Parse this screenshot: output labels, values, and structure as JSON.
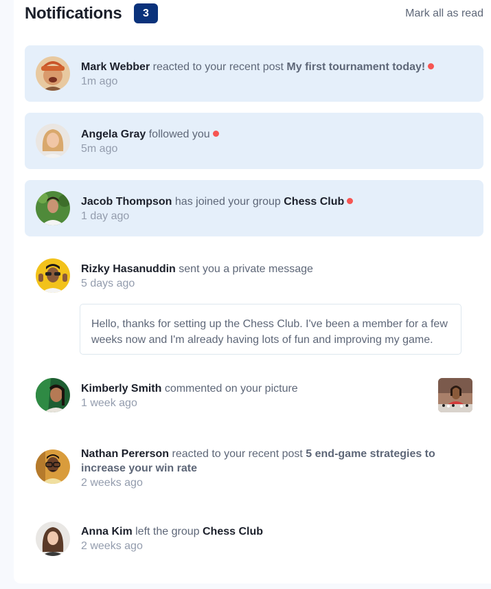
{
  "header": {
    "title": "Notifications",
    "badge_count": "3",
    "mark_all_label": "Mark all as read"
  },
  "notifications": [
    {
      "name": "Mark Webber",
      "action": "reacted to your recent post",
      "target": "My first tournament today!",
      "time": "1m ago",
      "unread": true,
      "avatar": "avatar-mark-webber"
    },
    {
      "name": "Angela Gray",
      "action": "followed you",
      "target": "",
      "time": "5m ago",
      "unread": true,
      "avatar": "avatar-angela-gray"
    },
    {
      "name": "Jacob Thompson",
      "action": "has joined your group",
      "target": "Chess Club",
      "time": "1 day ago",
      "unread": true,
      "avatar": "avatar-jacob-thompson"
    },
    {
      "name": "Rizky Hasanuddin",
      "action": "sent you a private message",
      "target": "",
      "time": "5 days ago",
      "unread": false,
      "avatar": "avatar-rizky-hasanuddin",
      "message": "Hello, thanks for setting up the Chess Club. I've been a member for a few weeks now and I'm already having lots of fun and improving my game."
    },
    {
      "name": "Kimberly Smith",
      "action": "commented on your picture",
      "target": "",
      "time": "1 week ago",
      "unread": false,
      "avatar": "avatar-kimberly-smith",
      "picture": "chess-picture"
    },
    {
      "name": "Nathan Pererson",
      "action": "reacted to your recent post",
      "target": "5 end-game strategies to increase your win rate",
      "time": "2 weeks ago",
      "unread": false,
      "avatar": "avatar-nathan-peterson"
    },
    {
      "name": "Anna Kim",
      "action": "left the group",
      "target": "Chess Club",
      "time": "2 weeks ago",
      "unread": false,
      "avatar": "avatar-anna-kim"
    }
  ],
  "colors": {
    "unread_bg": "#e5effa",
    "badge_bg": "#0a327b",
    "dot": "#f65552",
    "heading": "#1c202b",
    "text": "#5e6778"
  }
}
